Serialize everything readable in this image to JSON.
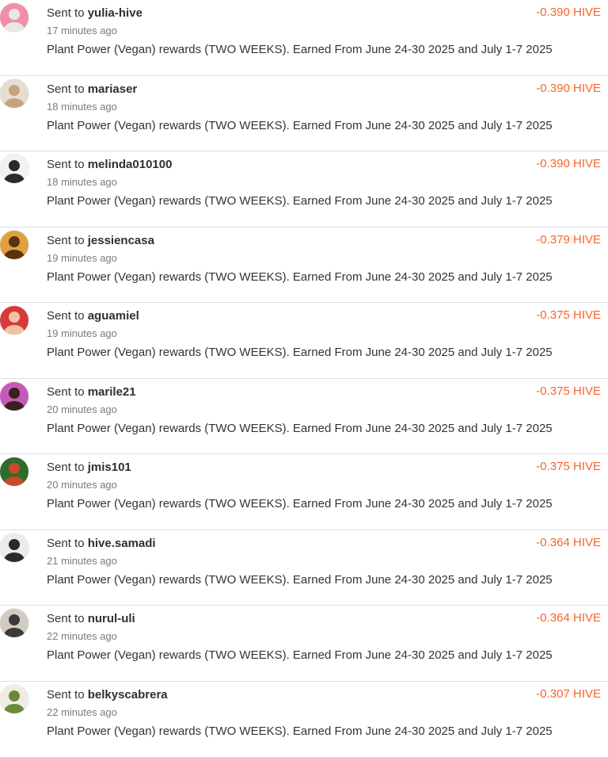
{
  "transfers": [
    {
      "prefix": "Sent to",
      "user": "yulia-hive",
      "time": "17 minutes ago",
      "memo": "Plant Power (Vegan) rewards (TWO WEEKS). Earned From June 24-30 2025 and July 1-7 2025",
      "amount": "-0.390 HIVE",
      "avatar_bg": "#f28ea8",
      "avatar_fg": "#e8e8e8"
    },
    {
      "prefix": "Sent to",
      "user": "mariaser",
      "time": "18 minutes ago",
      "memo": "Plant Power (Vegan) rewards (TWO WEEKS). Earned From June 24-30 2025 and July 1-7 2025",
      "amount": "-0.390 HIVE",
      "avatar_bg": "#e6dcd2",
      "avatar_fg": "#c8a27a"
    },
    {
      "prefix": "Sent to",
      "user": "melinda010100",
      "time": "18 minutes ago",
      "memo": "Plant Power (Vegan) rewards (TWO WEEKS). Earned From June 24-30 2025 and July 1-7 2025",
      "amount": "-0.390 HIVE",
      "avatar_bg": "#f2f2f2",
      "avatar_fg": "#2a2a2a"
    },
    {
      "prefix": "Sent to",
      "user": "jessiencasa",
      "time": "19 minutes ago",
      "memo": "Plant Power (Vegan) rewards (TWO WEEKS). Earned From June 24-30 2025 and July 1-7 2025",
      "amount": "-0.379 HIVE",
      "avatar_bg": "#e2a040",
      "avatar_fg": "#5a3410"
    },
    {
      "prefix": "Sent to",
      "user": "aguamiel",
      "time": "19 minutes ago",
      "memo": "Plant Power (Vegan) rewards (TWO WEEKS). Earned From June 24-30 2025 and July 1-7 2025",
      "amount": "-0.375 HIVE",
      "avatar_bg": "#d63a3a",
      "avatar_fg": "#f3c2a4"
    },
    {
      "prefix": "Sent to",
      "user": "marile21",
      "time": "20 minutes ago",
      "memo": "Plant Power (Vegan) rewards (TWO WEEKS). Earned From June 24-30 2025 and July 1-7 2025",
      "amount": "-0.375 HIVE",
      "avatar_bg": "#c65ab8",
      "avatar_fg": "#3a2020"
    },
    {
      "prefix": "Sent to",
      "user": "jmis101",
      "time": "20 minutes ago",
      "memo": "Plant Power (Vegan) rewards (TWO WEEKS). Earned From June 24-30 2025 and July 1-7 2025",
      "amount": "-0.375 HIVE",
      "avatar_bg": "#2f6b2a",
      "avatar_fg": "#c84a2a"
    },
    {
      "prefix": "Sent to",
      "user": "hive.samadi",
      "time": "21 minutes ago",
      "memo": "Plant Power (Vegan) rewards (TWO WEEKS). Earned From June 24-30 2025 and July 1-7 2025",
      "amount": "-0.364 HIVE",
      "avatar_bg": "#ececec",
      "avatar_fg": "#2a2a2a"
    },
    {
      "prefix": "Sent to",
      "user": "nurul-uli",
      "time": "22 minutes ago",
      "memo": "Plant Power (Vegan) rewards (TWO WEEKS). Earned From June 24-30 2025 and July 1-7 2025",
      "amount": "-0.364 HIVE",
      "avatar_bg": "#d2ccc0",
      "avatar_fg": "#3a3a3a"
    },
    {
      "prefix": "Sent to",
      "user": "belkyscabrera",
      "time": "22 minutes ago",
      "memo": "Plant Power (Vegan) rewards (TWO WEEKS). Earned From June 24-30 2025 and July 1-7 2025",
      "amount": "-0.307 HIVE",
      "avatar_bg": "#f0ece4",
      "avatar_fg": "#6a8a3a"
    }
  ]
}
